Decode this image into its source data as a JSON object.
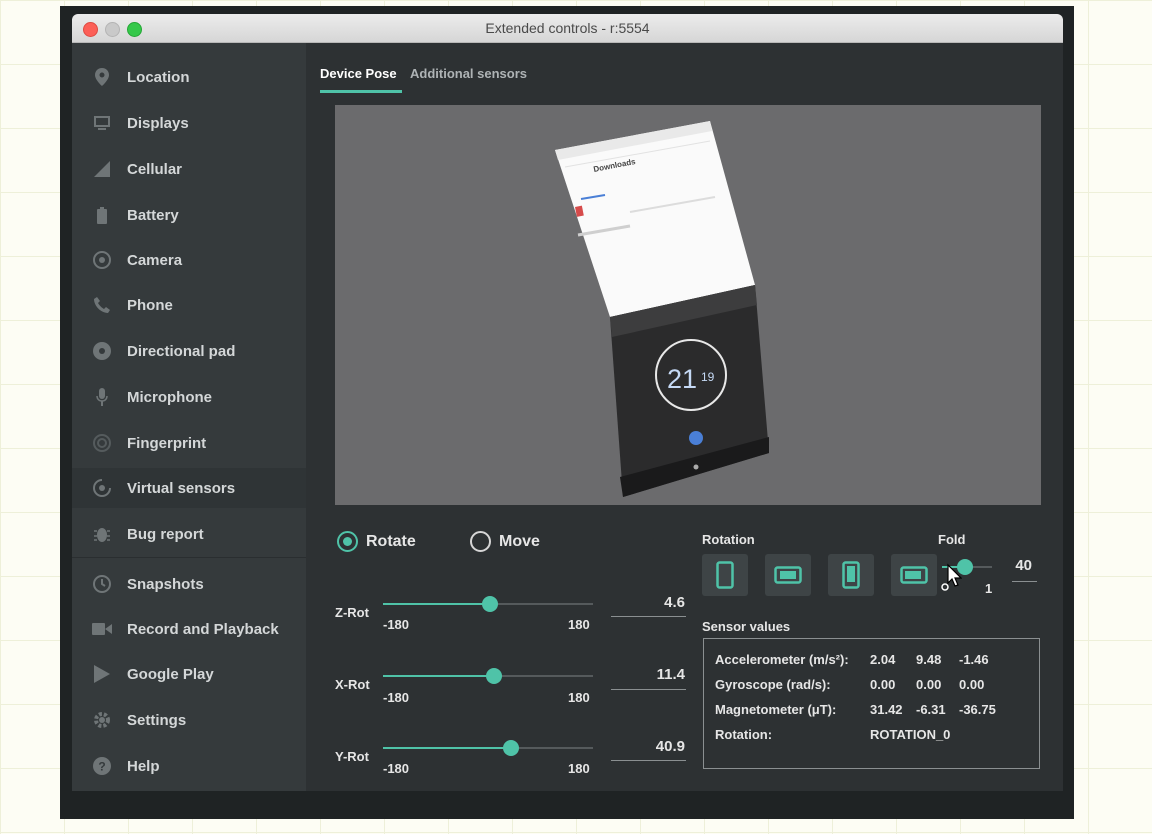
{
  "window": {
    "title": "Extended controls - r:5554"
  },
  "sidebar": {
    "items": [
      {
        "label": "Location",
        "icon": "location-pin-icon"
      },
      {
        "label": "Displays",
        "icon": "display-icon"
      },
      {
        "label": "Cellular",
        "icon": "cellular-signal-icon"
      },
      {
        "label": "Battery",
        "icon": "battery-icon"
      },
      {
        "label": "Camera",
        "icon": "camera-icon"
      },
      {
        "label": "Phone",
        "icon": "phone-icon"
      },
      {
        "label": "Directional pad",
        "icon": "dpad-icon"
      },
      {
        "label": "Microphone",
        "icon": "microphone-icon"
      },
      {
        "label": "Fingerprint",
        "icon": "fingerprint-icon"
      },
      {
        "label": "Virtual sensors",
        "icon": "rotate-sensor-icon",
        "active": true
      },
      {
        "label": "Bug report",
        "icon": "bug-icon"
      },
      {
        "label": "Snapshots",
        "icon": "history-icon"
      },
      {
        "label": "Record and Playback",
        "icon": "video-camera-icon"
      },
      {
        "label": "Google Play",
        "icon": "play-store-icon"
      },
      {
        "label": "Settings",
        "icon": "gear-icon"
      },
      {
        "label": "Help",
        "icon": "help-icon"
      }
    ]
  },
  "tabs": [
    {
      "label": "Device Pose",
      "active": true
    },
    {
      "label": "Additional sensors",
      "active": false
    }
  ],
  "device_screen": {
    "app_title": "Downloads",
    "clock_hours": "21",
    "clock_minutes": "19"
  },
  "mode": {
    "rotate_label": "Rotate",
    "move_label": "Move",
    "selected": "rotate"
  },
  "sliders": [
    {
      "label": "Z-Rot",
      "min": "-180",
      "max": "180",
      "value": "4.6",
      "fraction": 0.51
    },
    {
      "label": "X-Rot",
      "min": "-180",
      "max": "180",
      "value": "11.4",
      "fraction": 0.53
    },
    {
      "label": "Y-Rot",
      "min": "-180",
      "max": "180",
      "value": "40.9",
      "fraction": 0.61
    }
  ],
  "rotation": {
    "label": "Rotation"
  },
  "fold": {
    "label": "Fold",
    "value": "40",
    "min_label": "1",
    "fraction": 0.45
  },
  "sensor_values": {
    "label": "Sensor values",
    "rows": [
      {
        "name": "Accelerometer (m/s²):",
        "values": [
          "2.04",
          "9.48",
          "-1.46"
        ]
      },
      {
        "name": "Gyroscope (rad/s):",
        "values": [
          "0.00",
          "0.00",
          "0.00"
        ]
      },
      {
        "name": "Magnetometer (μT):",
        "values": [
          "31.42",
          "-6.31",
          "-36.75"
        ]
      },
      {
        "name": "Rotation:",
        "values": [
          "ROTATION_0"
        ]
      }
    ]
  },
  "colors": {
    "accent": "#4fc3a8",
    "sidebar": "#353a3c",
    "content": "#2d3133"
  }
}
